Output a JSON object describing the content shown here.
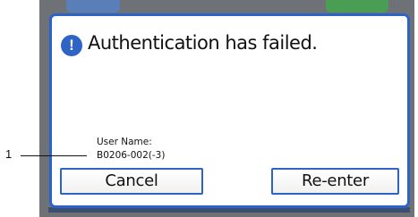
{
  "callout": {
    "number": "1"
  },
  "dialog": {
    "message": "Authentication has failed.",
    "alert_icon_glyph": "!",
    "user_name_label": "User Name:",
    "user_name_value": "B0206-002(-3)",
    "buttons": {
      "cancel_label": "Cancel",
      "reenter_label": "Re-enter"
    }
  },
  "colors": {
    "dialog_border": "#2b63c7",
    "alert_icon": "#2f64c7",
    "frame": "#6e7276",
    "status_tab": "#4a9e54"
  }
}
